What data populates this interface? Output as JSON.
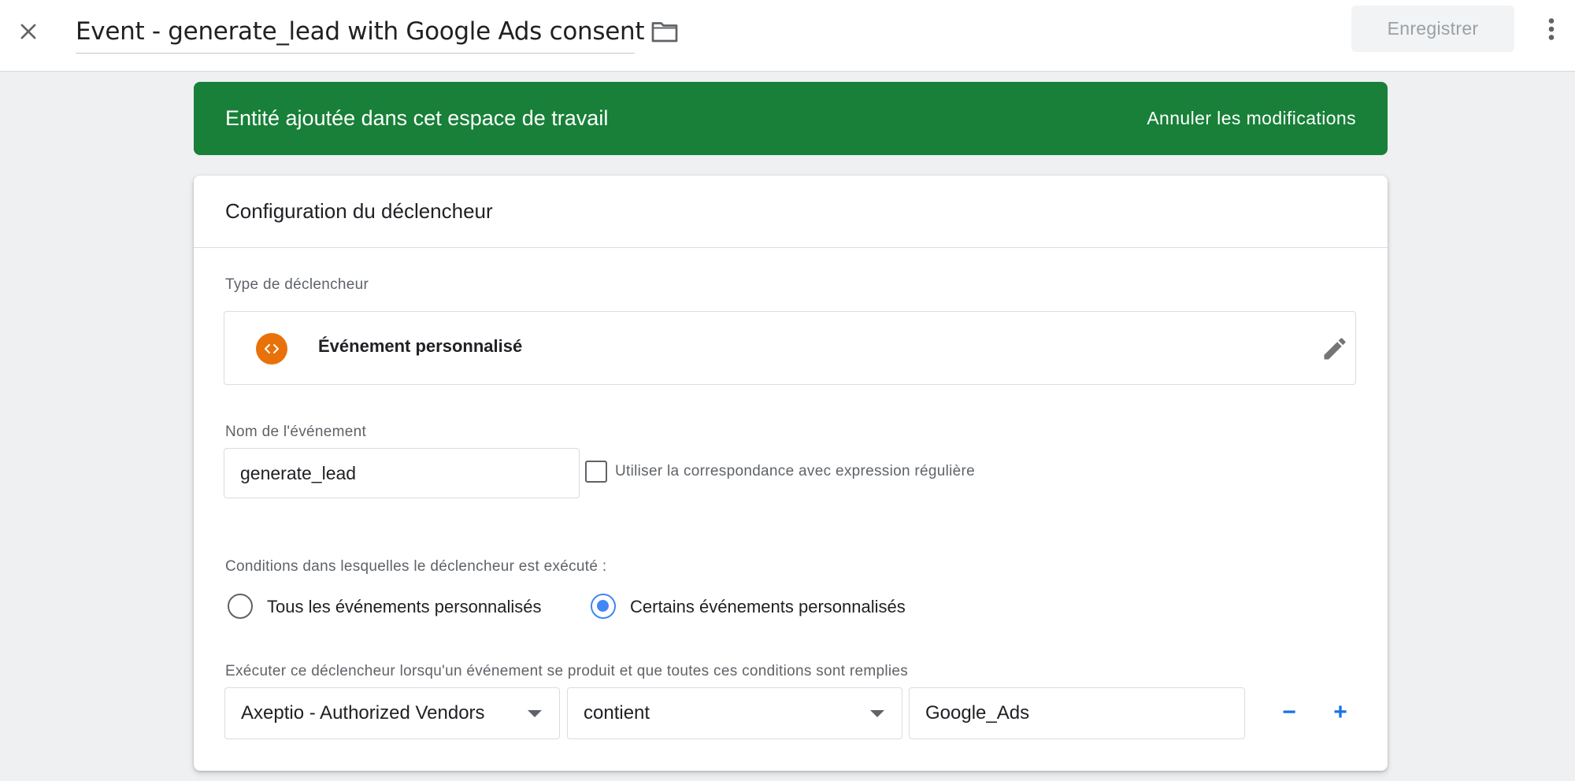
{
  "topbar": {
    "title": "Event - generate_lead with Google Ads consent",
    "save_label": "Enregistrer"
  },
  "banner": {
    "message": "Entité ajoutée dans cet espace de travail",
    "action": "Annuler les modifications"
  },
  "card": {
    "title": "Configuration du déclencheur",
    "trigger_type_label": "Type de déclencheur",
    "trigger_type_name": "Événement personnalisé",
    "event_name_label": "Nom de l'événement",
    "event_name_value": "generate_lead",
    "regex_label": "Utiliser la correspondance avec expression régulière",
    "regex_checked": false,
    "conditions_label": "Conditions dans lesquelles le déclencheur est exécuté :",
    "radio_options": [
      {
        "label": "Tous les événements personnalisés",
        "selected": false
      },
      {
        "label": "Certains événements personnalisés",
        "selected": true
      }
    ],
    "filter_label": "Exécuter ce déclencheur lorsqu'un événement se produit et que toutes ces conditions sont remplies",
    "filter": {
      "variable": "Axeptio - Authorized Vendors",
      "operator": "contient",
      "value": "Google_Ads",
      "remove_label": "−",
      "add_label": "+"
    }
  },
  "colors": {
    "banner_bg": "#188038",
    "trigger_icon_bg": "#e8710a",
    "accent_blue": "#1a73e8",
    "radio_selected": "#4285f4"
  },
  "icons": [
    "close-icon",
    "folder-icon",
    "more-vert-icon",
    "custom-event-icon",
    "edit-pencil-icon",
    "dropdown-caret-icon"
  ]
}
